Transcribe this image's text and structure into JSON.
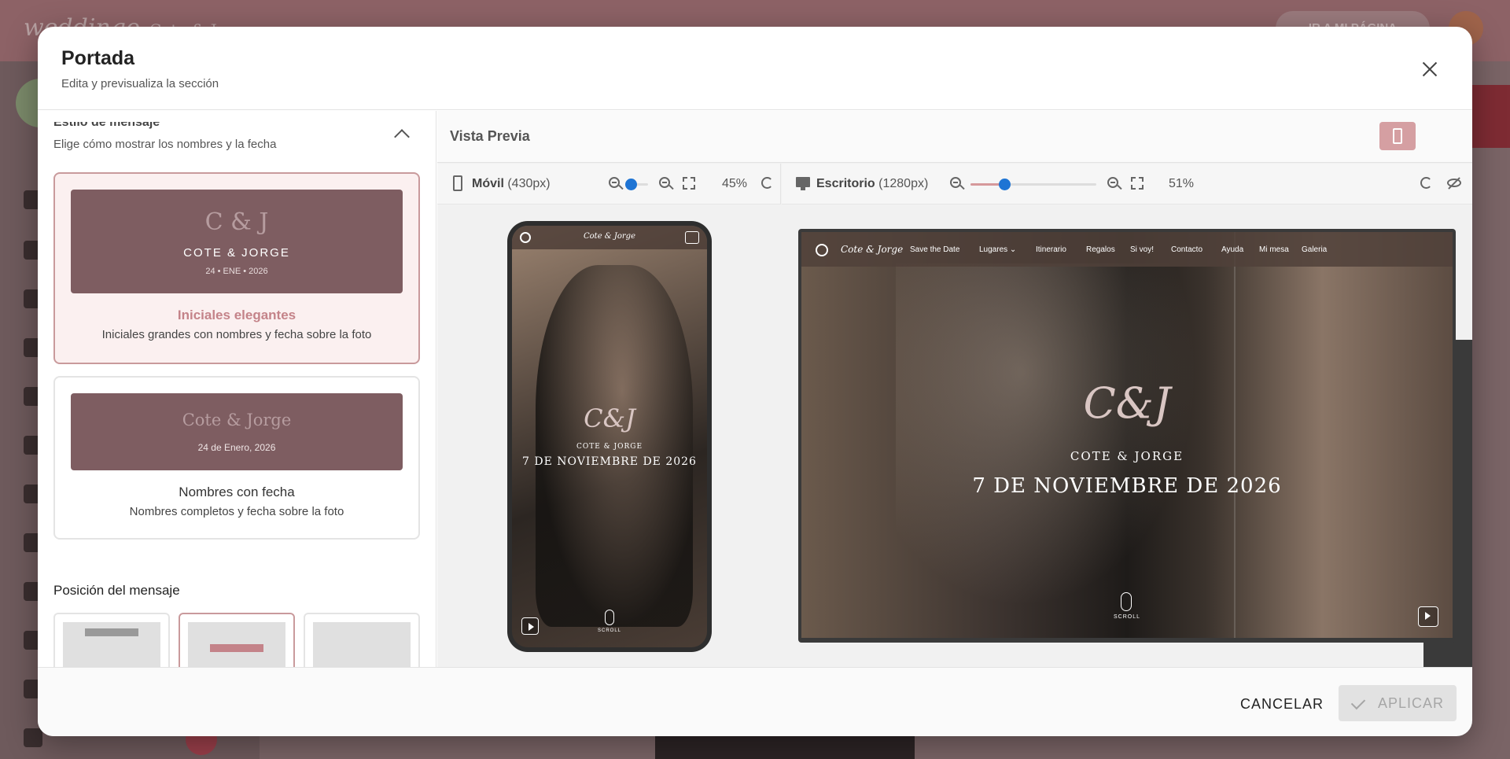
{
  "background": {
    "logo": "weddingo",
    "title": "Cote & Jorge",
    "page_button": "IR A MI PÁGINA"
  },
  "modal": {
    "title": "Portada",
    "subtitle": "Edita y previsualiza la sección"
  },
  "left_panel": {
    "section_title": "Estilo de mensaje",
    "section_desc": "Elige cómo mostrar los nombres y la fecha",
    "styles": [
      {
        "preview_initials": "C & J",
        "preview_names": "COTE & JORGE",
        "preview_date": "24 • ENE • 2026",
        "name": "Iniciales elegantes",
        "desc": "Iniciales grandes con nombres y fecha sobre la foto",
        "selected": true
      },
      {
        "preview_names": "Cote  &  Jorge",
        "preview_date": "24 de Enero, 2026",
        "name": "Nombres con fecha",
        "desc": "Nombres completos y fecha sobre la foto",
        "selected": false
      }
    ],
    "position_label": "Posición del mensaje",
    "position_selected_index": 1
  },
  "preview": {
    "title": "Vista Previa",
    "active_mode": "desktop",
    "mobile": {
      "label": "Móvil",
      "size": "(430px)",
      "zoom": "45%",
      "zoom_level": 0.1
    },
    "desktop": {
      "label": "Escritorio",
      "size": "(1280px)",
      "zoom": "51%",
      "zoom_level": 0.27
    },
    "site": {
      "brand": "Cote & Jorge",
      "initials": "C&J",
      "names": "COTE & JORGE",
      "date": "7 DE NOVIEMBRE DE 2026",
      "scroll": "SCROLL",
      "menu": [
        "Save the Date",
        "Lugares ⌄",
        "Itinerario",
        "Regalos",
        "Si voy!",
        "Contacto",
        "Ayuda",
        "Mi mesa",
        "Galeria"
      ]
    }
  },
  "footer": {
    "cancel": "CANCELAR",
    "apply": "APLICAR"
  },
  "colors": {
    "accent": "#c48389",
    "card_bg": "#7e5d61",
    "slider_knob": "#1e74d4"
  }
}
